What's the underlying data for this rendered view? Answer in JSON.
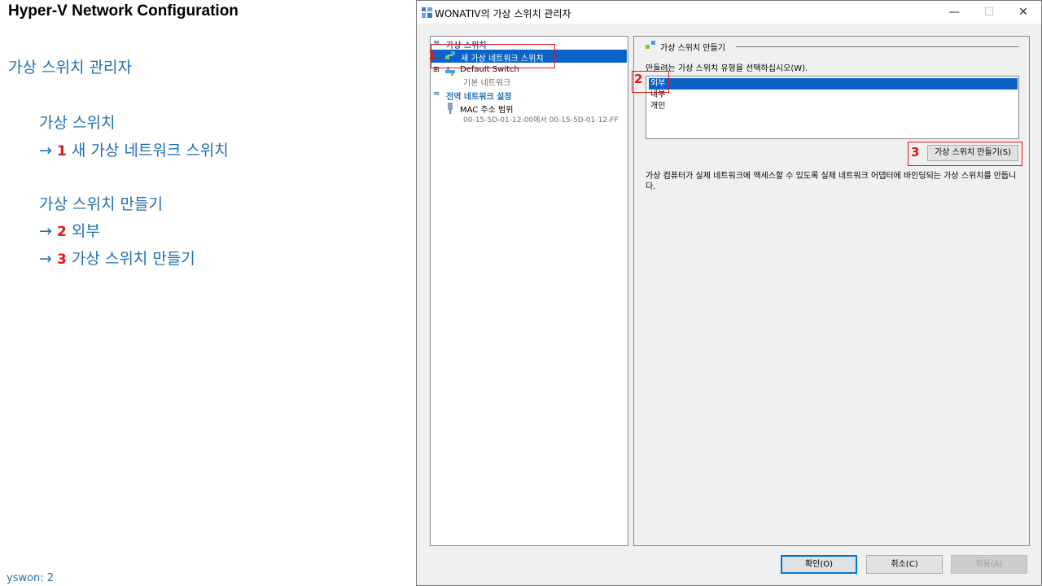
{
  "slide": {
    "title": "Hyper-V Network Configuration",
    "heading": "가상 스위치 관리자",
    "step1_label": "가상 스위치",
    "step1_arrow": "→",
    "step1_num": "1",
    "step1_text": "새 가상 네트워크 스위치",
    "step2_label": "가상 스위치  만들기",
    "step2_arrow": "→",
    "step2_num": "2",
    "step2_text": "외부",
    "step3_arrow": "→",
    "step3_num": "3",
    "step3_text": "가상 스위치  만들기",
    "footer": "yswon:   2"
  },
  "dialog": {
    "title": "WONATIV의 가상 스위치 관리자",
    "minimize": "—",
    "maximize": "☐",
    "close": "✕",
    "left_pane": {
      "section_virtual_switches": "가상 스위치",
      "new_switch_item": "새 가상 네트워크 스위치",
      "default_switch": "Default Switch",
      "default_switch_sub": "기본 네트워크",
      "section_global": "전역 네트워크 설정",
      "mac_range": "MAC 주소 범위",
      "mac_range_value": "00-15-5D-01-12-00에서 00-15-5D-01-12-FF"
    },
    "right_pane": {
      "group_title": "가상 스위치 만들기",
      "prompt": "만들려는 가상 스위치 유형을 선택하십시오(W).",
      "switch_types": [
        "외부",
        "내부",
        "개인"
      ],
      "selected_type": "외부",
      "create_button": "가상 스위치 만들기(S)",
      "description": "가상 컴퓨터가 실제 네트워크에 액세스할 수 있도록 실제 네트워크 어댑터에 바인딩되는 가상 스위치를 만듭니다."
    },
    "annotations": [
      "1",
      "2",
      "3"
    ],
    "buttons": {
      "ok": "확인(O)",
      "cancel": "취소(C)",
      "apply": "적용(A)"
    }
  },
  "colors": {
    "accent_blue": "#1f6fb5",
    "selection": "#0a64c8",
    "annotation_red": "#e0161b"
  }
}
